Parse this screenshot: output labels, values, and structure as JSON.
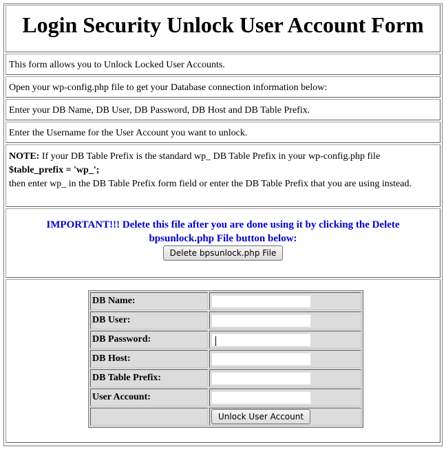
{
  "title": "Login Security Unlock User Account Form",
  "info_lines": [
    "This form allows you to Unlock Locked User Accounts.",
    "Open your wp-config.php file to get your Database connection information below:",
    "Enter your DB Name, DB User, DB Password, DB Host and DB Table Prefix.",
    "Enter the Username for the User Account you want to unlock."
  ],
  "note": {
    "label": "NOTE:",
    "text1": " If your DB Table Prefix is the standard wp_ DB Table Prefix in your wp-config.php file",
    "code": "$table_prefix = 'wp_';",
    "text2": "then enter wp_ in the DB Table Prefix form field or enter the DB Table Prefix that you are using instead."
  },
  "important": {
    "text": "IMPORTANT!!! Delete this file after you are done using it by clicking the Delete bpsunlock.php File button below:",
    "color": "#0000cc",
    "delete_button": "Delete bpsunlock.php File"
  },
  "form": {
    "fields": [
      {
        "label": "DB Name:",
        "value": ""
      },
      {
        "label": "DB User:",
        "value": ""
      },
      {
        "label": "DB Password:",
        "value": ""
      },
      {
        "label": "DB Host:",
        "value": ""
      },
      {
        "label": "DB Table Prefix:",
        "value": ""
      },
      {
        "label": "User Account:",
        "value": ""
      }
    ],
    "submit_button": "Unlock User Account"
  }
}
